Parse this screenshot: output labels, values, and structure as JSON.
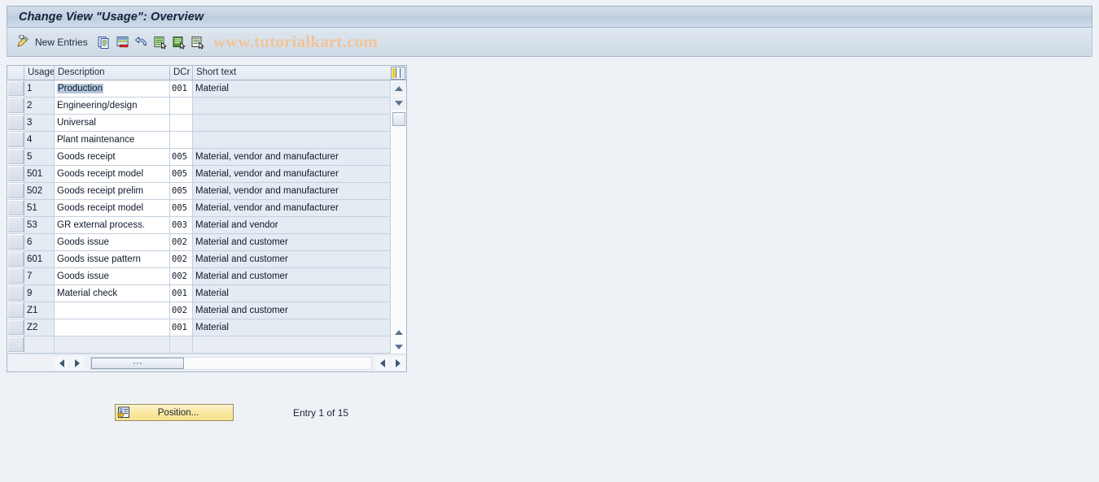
{
  "window": {
    "title": "Change View \"Usage\": Overview"
  },
  "toolbar": {
    "new_entries_label": "New Entries",
    "icons": [
      {
        "name": "new-entries-pencil-icon"
      },
      {
        "name": "copy-icon"
      },
      {
        "name": "delete-row-icon"
      },
      {
        "name": "undo-icon"
      },
      {
        "name": "select-all-icon"
      },
      {
        "name": "deselect-all-icon"
      },
      {
        "name": "variant-icon"
      }
    ],
    "watermark": "www.tutorialkart.com"
  },
  "grid": {
    "config_icon": "table-settings-icon",
    "columns": [
      {
        "key": "usage",
        "label": "Usage"
      },
      {
        "key": "description",
        "label": "Description"
      },
      {
        "key": "dcr",
        "label": "DCr"
      },
      {
        "key": "short_text",
        "label": "Short text"
      }
    ],
    "rows": [
      {
        "usage": "1",
        "description": "Production",
        "dcr": "001",
        "short_text": "Material",
        "selected_text": true
      },
      {
        "usage": "2",
        "description": "Engineering/design",
        "dcr": "",
        "short_text": ""
      },
      {
        "usage": "3",
        "description": "Universal",
        "dcr": "",
        "short_text": ""
      },
      {
        "usage": "4",
        "description": "Plant maintenance",
        "dcr": "",
        "short_text": ""
      },
      {
        "usage": "5",
        "description": "Goods receipt",
        "dcr": "005",
        "short_text": "Material, vendor and manufacturer"
      },
      {
        "usage": "501",
        "description": "Goods receipt model",
        "dcr": "005",
        "short_text": "Material, vendor and manufacturer"
      },
      {
        "usage": "502",
        "description": "Goods receipt prelim",
        "dcr": "005",
        "short_text": "Material, vendor and manufacturer"
      },
      {
        "usage": "51",
        "description": "Goods receipt model",
        "dcr": "005",
        "short_text": "Material, vendor and manufacturer"
      },
      {
        "usage": "53",
        "description": "GR external process.",
        "dcr": "003",
        "short_text": "Material and vendor"
      },
      {
        "usage": "6",
        "description": "Goods issue",
        "dcr": "002",
        "short_text": "Material and customer"
      },
      {
        "usage": "601",
        "description": "Goods issue pattern",
        "dcr": "002",
        "short_text": "Material and customer"
      },
      {
        "usage": "7",
        "description": "Goods issue",
        "dcr": "002",
        "short_text": "Material and customer"
      },
      {
        "usage": "9",
        "description": "Material check",
        "dcr": "001",
        "short_text": "Material"
      },
      {
        "usage": "Z1",
        "description": "",
        "dcr": "002",
        "short_text": "Material and customer"
      },
      {
        "usage": "Z2",
        "description": "",
        "dcr": "001",
        "short_text": "Material"
      },
      {
        "usage": "",
        "description": "",
        "dcr": "",
        "short_text": "",
        "empty": true
      }
    ]
  },
  "footer": {
    "position_button_label": "Position...",
    "entry_status": "Entry 1 of 15"
  },
  "colors": {
    "title_bar": "#c3d1e2",
    "toolbar": "#d6e0ea",
    "page_background": "#eef2f7",
    "row_alt": "#e3ebf3",
    "selection_highlight": "#b4c7dc",
    "watermark": "#f0c49a",
    "button_yellow": "#f9e79e"
  }
}
